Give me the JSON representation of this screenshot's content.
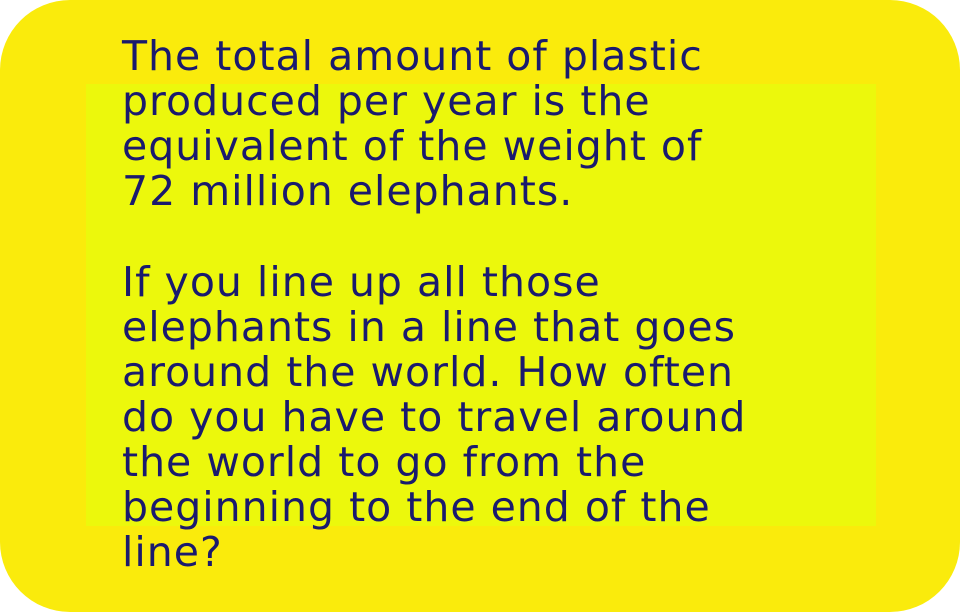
{
  "colors": {
    "card_background": "#FAEB0C",
    "inner_panel": "#ECF80C",
    "text": "#1A1A6E"
  },
  "paragraphs": [
    {
      "lines": [
        "The total amount of plastic",
        "produced per year is the",
        "equivalent of the weight of",
        "72 million elephants."
      ]
    },
    {
      "lines": [
        "If you line up all those",
        "elephants in a line that goes",
        "around the world. How often",
        "do you have to travel around",
        "the world to go from the",
        "beginning to the end of the",
        "line?"
      ]
    }
  ]
}
